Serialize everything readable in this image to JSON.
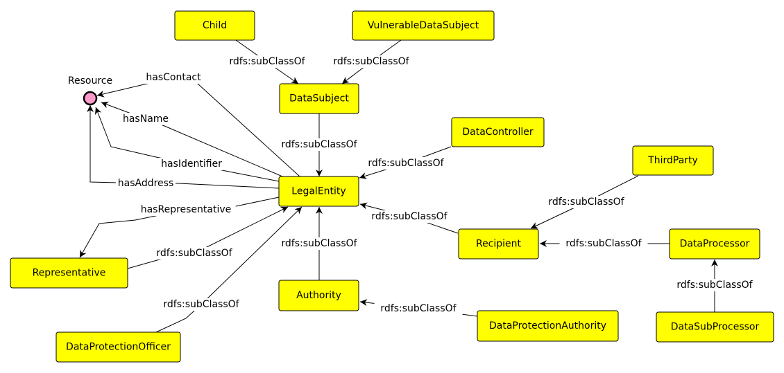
{
  "colors": {
    "class_fill": "#ffff00",
    "resource_fill": "#ff99cc",
    "stroke": "#000000"
  },
  "resource": {
    "label": "Resource"
  },
  "nodes": {
    "child": "Child",
    "vulnerable": "VulnerableDataSubject",
    "datasubject": "DataSubject",
    "datacontroller": "DataController",
    "thirdparty": "ThirdParty",
    "legalentity": "LegalEntity",
    "recipient": "Recipient",
    "dataprocessor": "DataProcessor",
    "representative": "Representative",
    "authority": "Authority",
    "dpa": "DataProtectionAuthority",
    "datasubprocessor": "DataSubProcessor",
    "dpo": "DataProtectionOfficer"
  },
  "edges": [
    {
      "from": "Child",
      "to": "DataSubject",
      "label": "rdfs:subClassOf"
    },
    {
      "from": "VulnerableDataSubject",
      "to": "DataSubject",
      "label": "rdfs:subClassOf"
    },
    {
      "from": "DataSubject",
      "to": "LegalEntity",
      "label": "rdfs:subClassOf"
    },
    {
      "from": "DataController",
      "to": "LegalEntity",
      "label": "rdfs:subClassOf"
    },
    {
      "from": "LegalEntity",
      "to": "Resource",
      "label": "hasContact"
    },
    {
      "from": "LegalEntity",
      "to": "Resource",
      "label": "hasName"
    },
    {
      "from": "LegalEntity",
      "to": "Resource",
      "label": "hasIdentifier"
    },
    {
      "from": "LegalEntity",
      "to": "Resource",
      "label": "hasAddress"
    },
    {
      "from": "LegalEntity",
      "to": "Representative",
      "label": "hasRepresentative"
    },
    {
      "from": "Representative",
      "to": "LegalEntity",
      "label": "rdfs:subClassOf"
    },
    {
      "from": "DataProtectionOfficer",
      "to": "LegalEntity",
      "label": "rdfs:subClassOf"
    },
    {
      "from": "Authority",
      "to": "LegalEntity",
      "label": "rdfs:subClassOf"
    },
    {
      "from": "Recipient",
      "to": "LegalEntity",
      "label": "rdfs:subClassOf"
    },
    {
      "from": "ThirdParty",
      "to": "Recipient",
      "label": "rdfs:subClassOf"
    },
    {
      "from": "DataProcessor",
      "to": "Recipient",
      "label": "rdfs:subClassOf"
    },
    {
      "from": "DataSubProcessor",
      "to": "DataProcessor",
      "label": "rdfs:subClassOf"
    },
    {
      "from": "DataProtectionAuthority",
      "to": "Authority",
      "label": "rdfs:subClassOf"
    }
  ]
}
